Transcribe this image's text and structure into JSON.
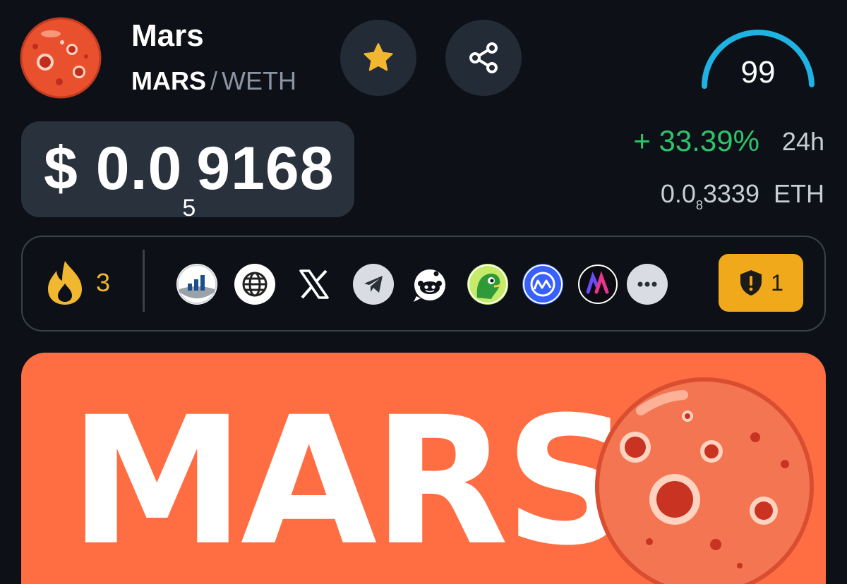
{
  "header": {
    "token_name": "Mars",
    "base_symbol": "MARS",
    "separator": "/",
    "quote_symbol": "WETH",
    "score": "99",
    "score_fraction": 0.99
  },
  "price": {
    "currency": "$",
    "prefix": "0.0",
    "zero_count": "5",
    "digits": "9168"
  },
  "change": {
    "value": "+ 33.39%",
    "period": "24h",
    "color": "#2ec26a"
  },
  "eth_price": {
    "prefix": "0.0",
    "zero_count": "8",
    "digits": "3339",
    "unit": "ETH"
  },
  "links": {
    "fire_count": "3",
    "icons": [
      "chart-logo-icon",
      "globe-icon",
      "x-icon",
      "telegram-icon",
      "reddit-icon",
      "coingecko-icon",
      "coinmarketcap-icon",
      "app-m-icon",
      "more-icon"
    ],
    "warning_count": "1"
  },
  "banner": {
    "text": "MARS"
  },
  "colors": {
    "background": "#0d1117",
    "accent_gauge": "#1fb3e3",
    "warning": "#f0a91a",
    "banner": "#ff6e42"
  }
}
